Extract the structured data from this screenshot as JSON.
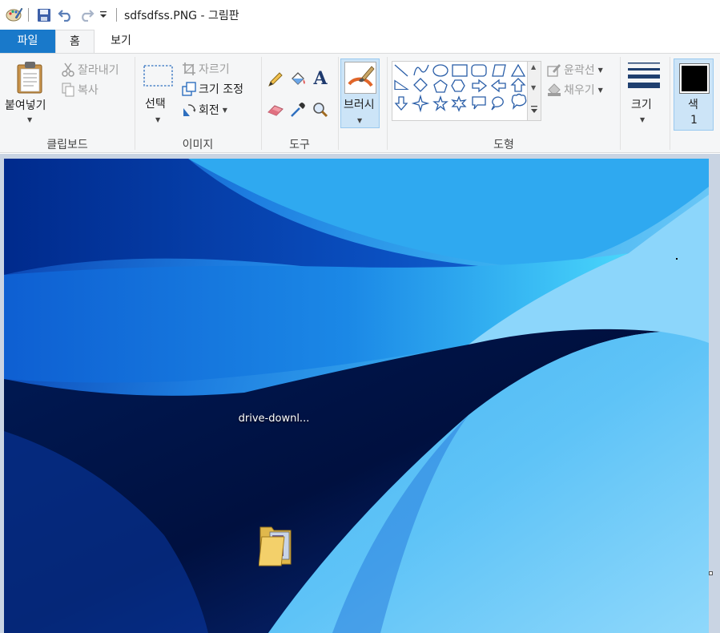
{
  "window": {
    "title": "sdfsdfss.PNG - 그림판"
  },
  "tabs": {
    "file": "파일",
    "home": "홈",
    "view": "보기"
  },
  "clipboard": {
    "paste": "붙여넣기",
    "cut": "잘라내기",
    "copy": "복사",
    "group": "클립보드"
  },
  "image": {
    "select": "선택",
    "crop": "자르기",
    "resize": "크기 조정",
    "rotate": "회전",
    "group": "이미지"
  },
  "tools": {
    "group": "도구",
    "text_glyph": "A"
  },
  "brushes": {
    "label": "브러시"
  },
  "shapes": {
    "outline": "윤곽선",
    "fill": "채우기",
    "group": "도형"
  },
  "size": {
    "label": "크기"
  },
  "color": {
    "label": "색",
    "index": "1",
    "current_hex": "#000000"
  },
  "desktop": {
    "icon_label": "drive-downl..."
  },
  "colors": {
    "file_tab": "#1979ca",
    "ribbon_bg": "#f5f6f7",
    "selected_bg": "#cce4f7",
    "workspace_bg": "#c9d4e3"
  }
}
